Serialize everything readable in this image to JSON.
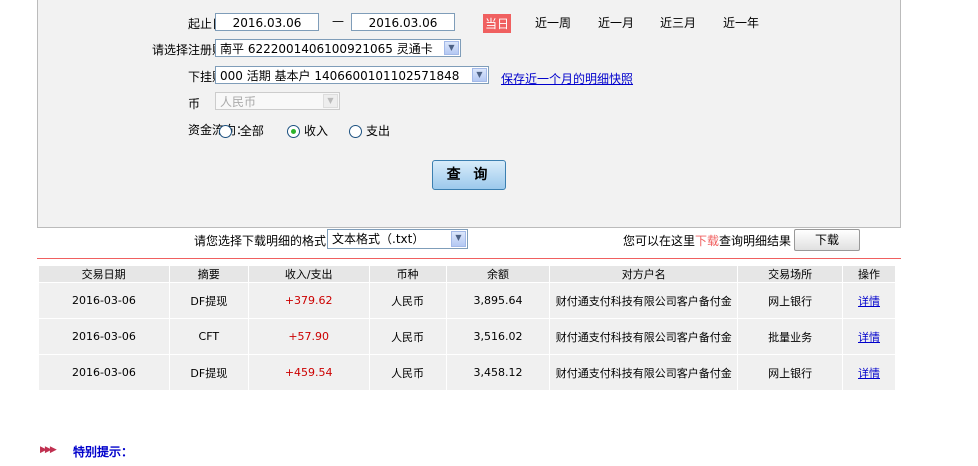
{
  "form": {
    "date_label": "起止日期：",
    "start_date": "2016.03.06",
    "date_sep": "—",
    "end_date": "2016.03.06",
    "quick_ranges": [
      "当日",
      "近一周",
      "近一月",
      "近三月",
      "近一年"
    ],
    "account_label": "请选择注册账户：",
    "account_value": "南平  6222001406100921065 灵通卡",
    "sub_account_label": "下挂账户：",
    "sub_account_value": "000 活期 基本户 1406600101102571848",
    "save_snapshot_link": "保存近一个月的明细快照",
    "currency_label": "币　　种：",
    "currency_value": "人民币",
    "flow_label": "资金流向：",
    "flow_options": [
      "全部",
      "收入",
      "支出"
    ],
    "flow_selected": "收入",
    "query_button": "查 询"
  },
  "download": {
    "format_label": "请您选择下载明细的格式",
    "format_value": "文本格式（.txt）",
    "hint_prefix": "您可以在这里",
    "hint_link": "下载",
    "hint_suffix": "查询明细结果",
    "button": "下载"
  },
  "table": {
    "headers": [
      "交易日期",
      "摘要",
      "收入/支出",
      "币种",
      "余额",
      "对方户名",
      "交易场所",
      "操作"
    ],
    "rows": [
      [
        "2016-03-06",
        "DF提现",
        "+379.62",
        "人民币",
        "3,895.64",
        "财付通支付科技有限公司客户备付金",
        "网上银行",
        "详情"
      ],
      [
        "2016-03-06",
        "CFT",
        "+57.90",
        "人民币",
        "3,516.02",
        "财付通支付科技有限公司客户备付金",
        "批量业务",
        "详情"
      ],
      [
        "2016-03-06",
        "DF提现",
        "+459.54",
        "人民币",
        "3,458.12",
        "财付通支付科技有限公司客户备付金",
        "网上银行",
        "详情"
      ]
    ]
  },
  "notice": {
    "title": "特别提示："
  },
  "colors": {
    "accent_red": "#f06060",
    "amount": "#cc0000",
    "link": "#0000cc"
  }
}
